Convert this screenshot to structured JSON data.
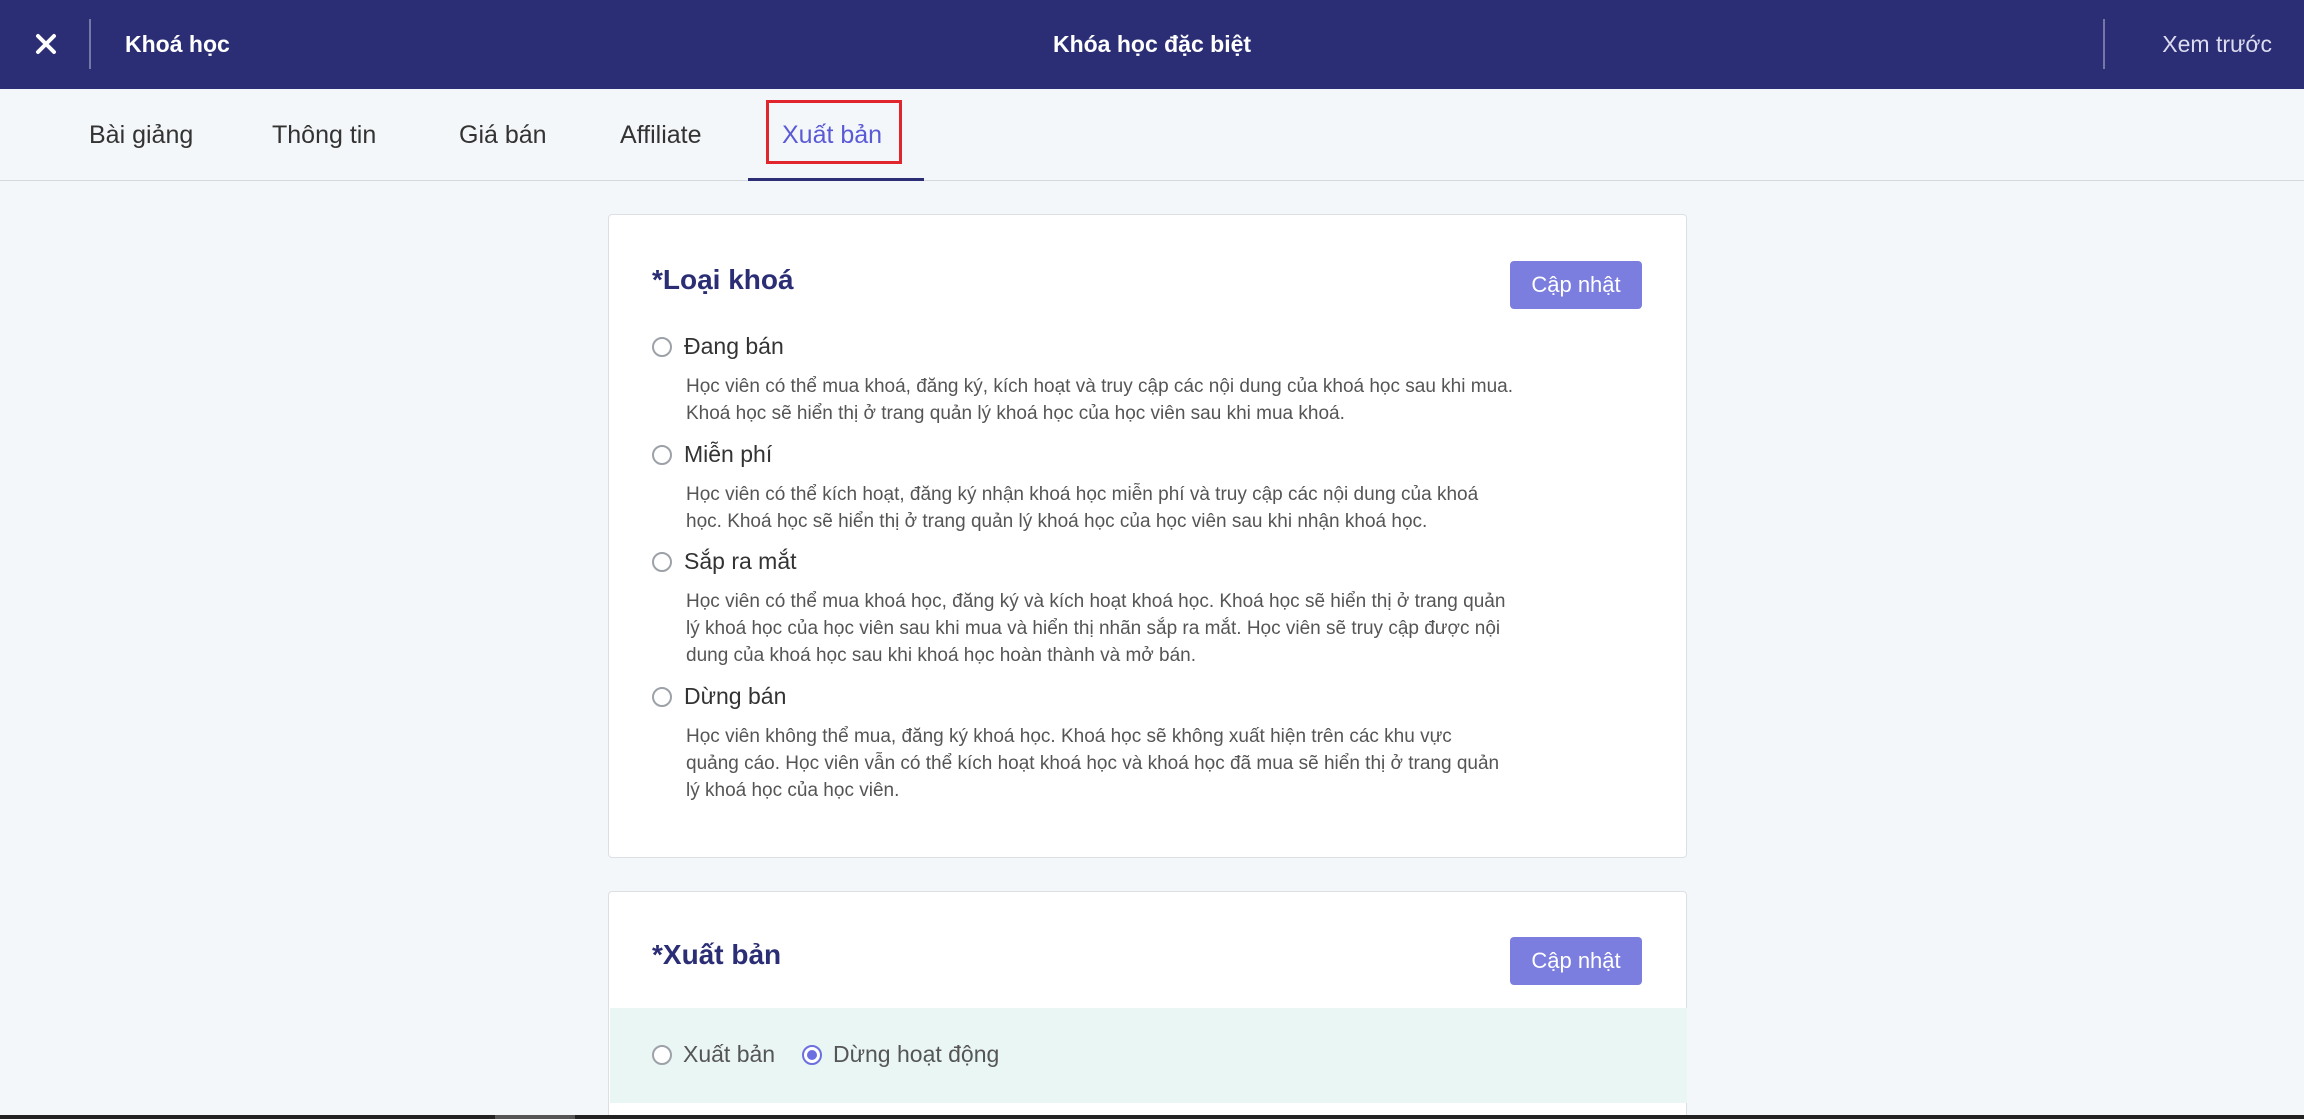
{
  "topbar": {
    "back_label": "Khoá học",
    "title": "Khóa học đặc biệt",
    "preview_label": "Xem trước"
  },
  "tabs": [
    {
      "label": "Bài giảng"
    },
    {
      "label": "Thông tin"
    },
    {
      "label": "Giá bán"
    },
    {
      "label": "Affiliate"
    },
    {
      "label": "Xuất bản",
      "active": true
    }
  ],
  "course_type": {
    "title": "*Loại khoá",
    "update_label": "Cập nhật",
    "options": [
      {
        "label": "Đang bán",
        "desc_lines": [
          "Học viên có thể mua khoá, đăng ký, kích hoạt và truy cập các nội dung của khoá học sau khi mua.",
          "Khoá học sẽ hiển thị ở trang quản lý khoá học của học viên sau khi mua khoá."
        ],
        "selected": false
      },
      {
        "label": "Miễn phí",
        "desc_lines": [
          "Học viên có thể kích hoạt, đăng ký nhận khoá học miễn phí và truy cập các nội dung của khoá",
          "học. Khoá học sẽ hiển thị ở trang quản lý khoá học của học viên sau khi nhận khoá học."
        ],
        "selected": false
      },
      {
        "label": "Sắp ra mắt",
        "desc_lines": [
          "Học viên có thể mua khoá học, đăng ký và kích hoạt khoá học. Khoá học sẽ hiển thị ở trang quản",
          "lý khoá học của học viên sau khi mua và hiển thị nhãn sắp ra mắt. Học viên sẽ truy cập được nội",
          "dung của khoá học sau khi khoá học hoàn thành và mở bán."
        ],
        "selected": false
      },
      {
        "label": "Dừng bán",
        "desc_lines": [
          "Học viên không thể mua, đăng ký khoá học. Khoá học sẽ không xuất hiện trên các khu vực",
          "quảng cáo. Học viên vẫn có thể kích hoạt khoá học và khoá học đã mua sẽ hiển thị ở trang quản",
          "lý khoá học của học viên."
        ],
        "selected": false
      }
    ]
  },
  "publish": {
    "title": "*Xuất bản",
    "update_label": "Cập nhật",
    "options": [
      {
        "label": "Xuất bản",
        "selected": false
      },
      {
        "label": "Dừng hoạt động",
        "selected": true
      }
    ]
  },
  "colors": {
    "topbar": "#2b2e74",
    "accent": "#6c6fe0",
    "button": "#7b7ddf",
    "highlight": "#e0262c"
  }
}
